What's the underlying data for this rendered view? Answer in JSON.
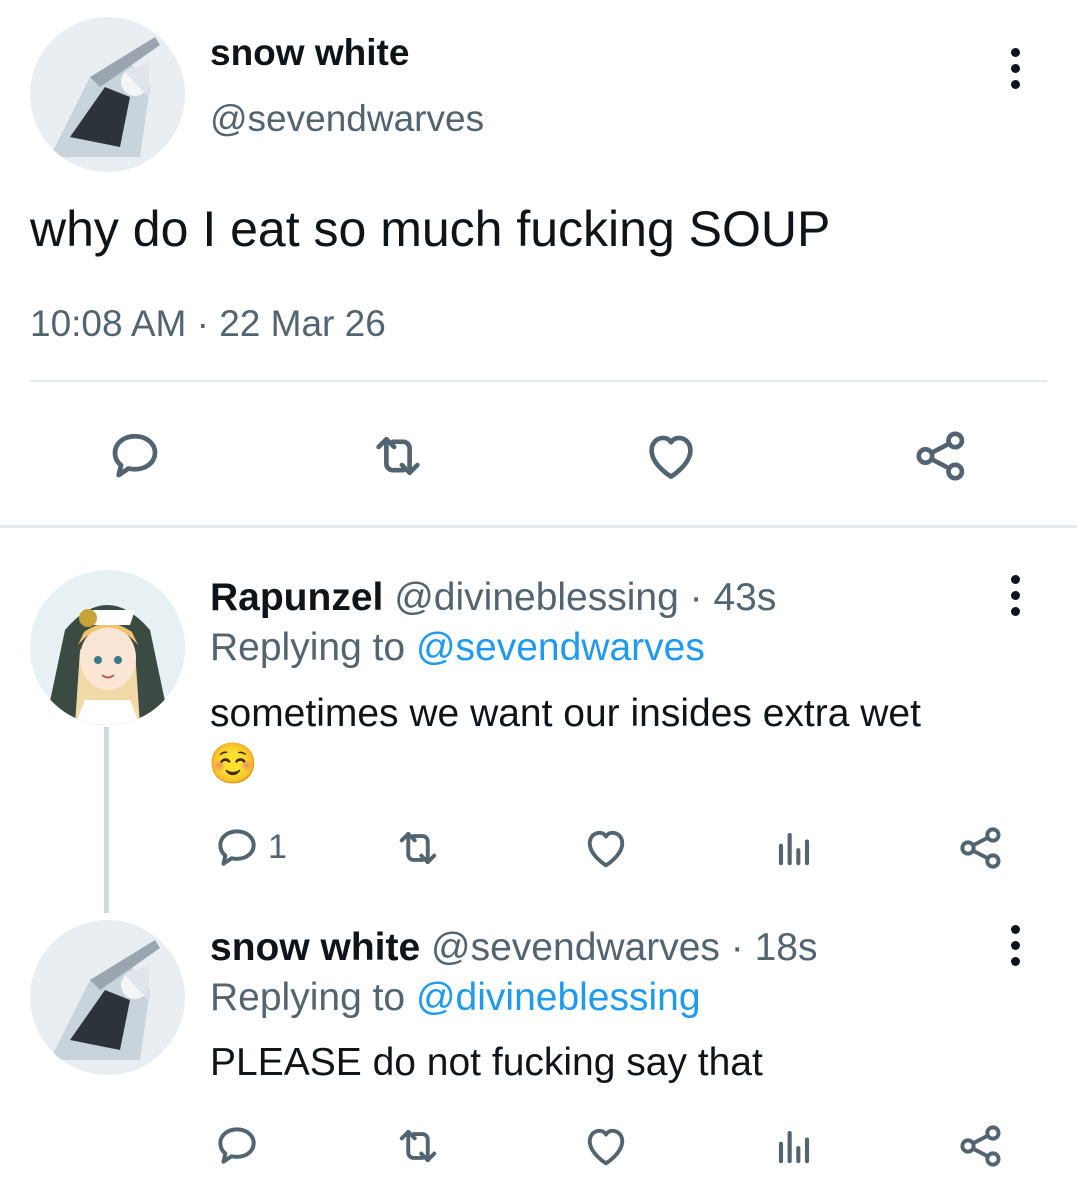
{
  "main_tweet": {
    "author_name": "snow white",
    "author_handle": "@sevendwarves",
    "text": "why do I eat so much fucking SOUP",
    "time": "10:08 AM · 22 Mar 26",
    "actions": {
      "reply": "reply-icon",
      "retweet": "retweet-icon",
      "like": "heart-icon",
      "share": "share-icon"
    }
  },
  "replies": [
    {
      "author_name": "Rapunzel",
      "author_handle": "@divineblessing",
      "time_sep": " · ",
      "time": "43s",
      "replying_prefix": "Replying to ",
      "replying_to": "@sevendwarves",
      "text": "sometimes we want our insides extra wet",
      "emoji": "☺️",
      "reply_count": "1"
    },
    {
      "author_name": "snow white",
      "author_handle": "@sevendwarves",
      "time_sep": " · ",
      "time": "18s",
      "replying_prefix": "Replying to ",
      "replying_to": "@divineblessing",
      "text": "PLEASE do not fucking say that"
    }
  ],
  "colors": {
    "link": "#1d9bf0",
    "muted": "#536471",
    "text": "#0f1419",
    "divider": "#e6e9ec"
  }
}
